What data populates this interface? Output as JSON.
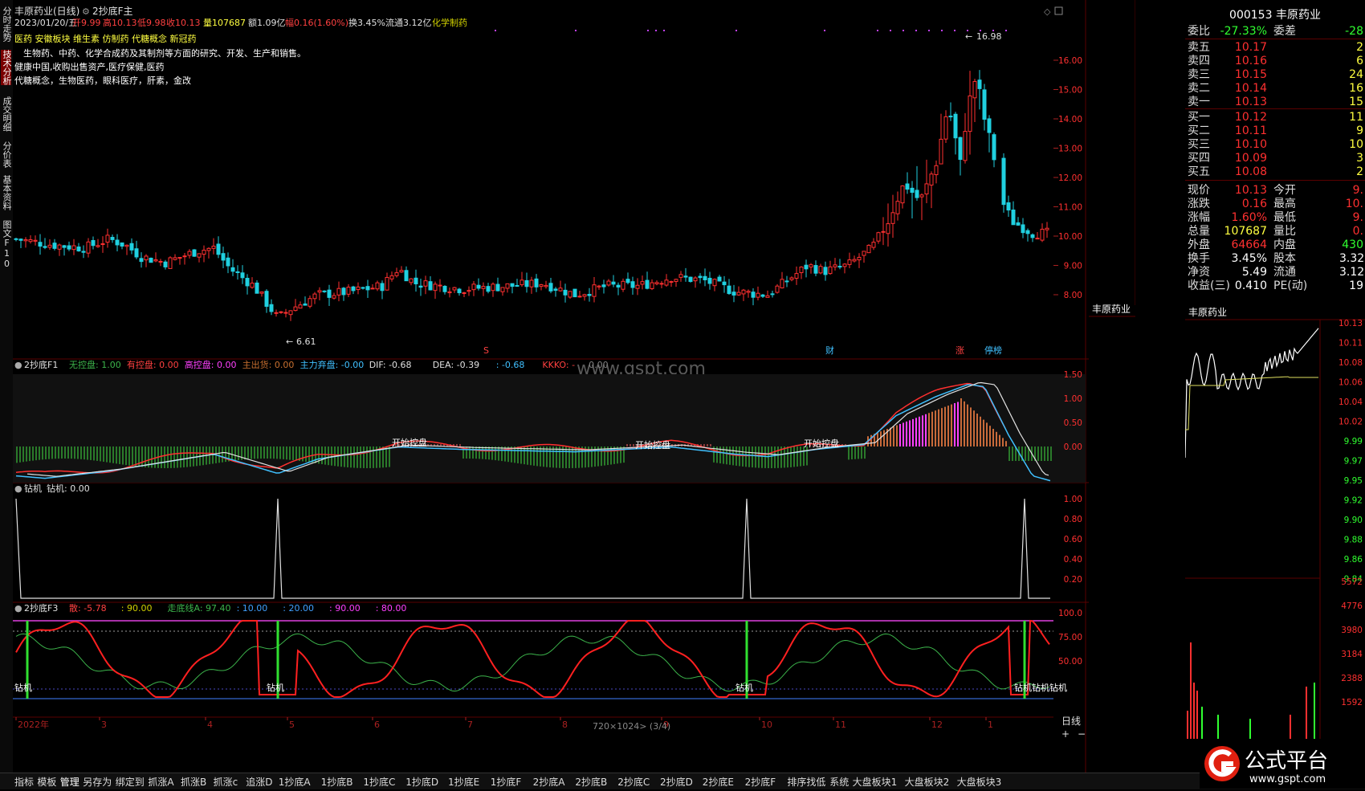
{
  "window": {
    "stock_name_period": "丰原药业(日线)",
    "formula_name": "2抄底F主",
    "date": "2023/01/20/五",
    "open": "开9.99",
    "high": "高10.13",
    "low": "低9.98",
    "close": "收10.13",
    "volume": "量107687",
    "amount": "额1.09亿",
    "change": "幅0.16(1.60%)",
    "turnover": "换3.45%",
    "float_cap": "流通3.12亿",
    "industry": "化学制药"
  },
  "info_lines": [
    "医药 安徽板块 维生素 仿制药 代糖概念 新冠药",
    "　生物药、中药、化学合成药及其制剂等方面的研究、开发、生产和销售。",
    "健康中国,收购出售资产,医疗保健,医药",
    "代糖概念，生物医药，眼科医疗，肝素，金改"
  ],
  "left_tabs": [
    "分时走势",
    "技术分析",
    "成交明细",
    "分价表",
    "基本资料",
    "图文F10"
  ],
  "main_chart": {
    "price_ticks": [
      "16.00",
      "15.00",
      "14.00",
      "13.00",
      "12.00",
      "11.00",
      "10.00",
      "9.00",
      "8.00"
    ],
    "max_label": "16.98",
    "min_label": "6.61",
    "markers": [
      "S",
      "财",
      "涨",
      "停榜"
    ],
    "watermark": "www.gspt.com"
  },
  "f1": {
    "title": "2抄底F1",
    "items": [
      {
        "text": "无控盘: 1.00",
        "color": "#3cb44b"
      },
      {
        "text": "有控盘: 0.00",
        "color": "#ff4040"
      },
      {
        "text": "高控盘: 0.00",
        "color": "#ff40ff"
      },
      {
        "text": "主出货: 0.00",
        "color": "#c87030"
      },
      {
        "text": "主力弃盘: -0.00",
        "color": "#40c0ff"
      },
      {
        "text": "DIF: -0.68",
        "color": "#e0e0e0"
      },
      {
        "text": "DEA: -0.39",
        "color": "#e0e0e0"
      },
      {
        "text": ": -0.68",
        "color": "#40c0ff"
      },
      {
        "text": "KKKO: -",
        "color": "#ff4040"
      },
      {
        "text": "0.00",
        "color": "#808080"
      }
    ],
    "ticks": [
      "1.50",
      "1.00",
      "0.50",
      "0.00"
    ],
    "labels": [
      "开始控盘",
      "开始控盘",
      "开始控盘"
    ]
  },
  "zj": {
    "title": "钻机",
    "value": "钻机: 0.00",
    "ticks": [
      "1.00",
      "0.80",
      "0.60",
      "0.40",
      "0.20"
    ]
  },
  "f3": {
    "title": "2抄底F3",
    "items": [
      {
        "text": "散: -5.78",
        "color": "#ff4040"
      },
      {
        "text": ": 90.00",
        "color": "#d0d000"
      },
      {
        "text": "走底线A: 97.40",
        "color": "#3cb44b"
      },
      {
        "text": ": 10.00",
        "color": "#40a0ff"
      },
      {
        "text": ": 20.00",
        "color": "#40a0ff"
      },
      {
        "text": ": 90.00",
        "color": "#ff40ff"
      },
      {
        "text": ": 80.00",
        "color": "#ff40ff"
      }
    ],
    "ticks": [
      "100.0",
      "75.00",
      "50.00"
    ],
    "zj_labels": [
      "钻机",
      "钻机",
      "钻机",
      "钻机钻机钻机"
    ]
  },
  "time_axis": {
    "labels": [
      "2022年",
      "3",
      "4",
      "5",
      "6",
      "7",
      "8",
      "9",
      "10",
      "11",
      "12",
      "1"
    ],
    "status": "720×1024> (3/4)",
    "period": "日线"
  },
  "quote": {
    "code_name": "000153 丰原药业",
    "weibi": {
      "label": "委比",
      "value": "-27.33%",
      "label2": "委差",
      "value2": "-28"
    },
    "asks": [
      {
        "label": "卖五",
        "price": "10.17",
        "vol": "2"
      },
      {
        "label": "卖四",
        "price": "10.16",
        "vol": "6"
      },
      {
        "label": "卖三",
        "price": "10.15",
        "vol": "24"
      },
      {
        "label": "卖二",
        "price": "10.14",
        "vol": "16"
      },
      {
        "label": "卖一",
        "price": "10.13",
        "vol": "15"
      }
    ],
    "bids": [
      {
        "label": "买一",
        "price": "10.12",
        "vol": "11"
      },
      {
        "label": "买二",
        "price": "10.11",
        "vol": "9"
      },
      {
        "label": "买三",
        "price": "10.10",
        "vol": "10"
      },
      {
        "label": "买四",
        "price": "10.09",
        "vol": "3"
      },
      {
        "label": "买五",
        "price": "10.08",
        "vol": "2"
      }
    ],
    "stats": [
      {
        "l": "现价",
        "v": "10.13",
        "vc": "#ff3030",
        "l2": "今开",
        "v2": "9.",
        "v2c": "#ff3030"
      },
      {
        "l": "涨跌",
        "v": "0.16",
        "vc": "#ff3030",
        "l2": "最高",
        "v2": "10.",
        "v2c": "#ff3030"
      },
      {
        "l": "涨幅",
        "v": "1.60%",
        "vc": "#ff3030",
        "l2": "最低",
        "v2": "9.",
        "v2c": "#ff3030"
      },
      {
        "l": "总量",
        "v": "107687",
        "vc": "#ffff40",
        "l2": "量比",
        "v2": "0.",
        "v2c": "#ff3030"
      },
      {
        "l": "外盘",
        "v": "64664",
        "vc": "#ff3030",
        "l2": "内盘",
        "v2": "430",
        "v2c": "#30ff30"
      },
      {
        "l": "换手",
        "v": "3.45%",
        "vc": "#ffffff",
        "l2": "股本",
        "v2": "3.32",
        "v2c": "#ffffff"
      },
      {
        "l": "净资",
        "v": "5.49",
        "vc": "#ffffff",
        "l2": "流通",
        "v2": "3.12",
        "v2c": "#ffffff"
      },
      {
        "l": "收益(三)",
        "v": "0.410",
        "vc": "#ffffff",
        "l2": "PE(动)",
        "v2": "19",
        "v2c": "#ffffff"
      }
    ]
  },
  "intraday": {
    "title": "丰原药业",
    "price_ticks": [
      "10.13",
      "10.11",
      "10.08",
      "10.06",
      "10.04",
      "10.02",
      "9.99",
      "9.97",
      "9.95",
      "9.92",
      "9.90",
      "9.88",
      "9.86",
      "9.84"
    ],
    "vol_ticks": [
      "5572",
      "4776",
      "3980",
      "3184",
      "2388",
      "1592"
    ]
  },
  "bottom_tabs": [
    "指标",
    "模板",
    "管理",
    "另存为",
    "绑定到",
    "抓涨A",
    "抓涨B",
    "抓涨c",
    "追涨D",
    "1抄底A",
    "1抄底B",
    "1抄底C",
    "1抄底D",
    "1抄底E",
    "1抄底F",
    "2抄底A",
    "2抄底B",
    "2抄底C",
    "2抄底D",
    "2抄底E",
    "2抄底F",
    "排序找低",
    "系统",
    "大盘板块1",
    "大盘板块2",
    "大盘板块3"
  ],
  "brand": {
    "title": "公式平台",
    "url": "www.gspt.com"
  },
  "colors": {
    "up": "#ff3030",
    "down": "#20d0e0",
    "bg": "#000000",
    "accent": "#7a0000"
  }
}
